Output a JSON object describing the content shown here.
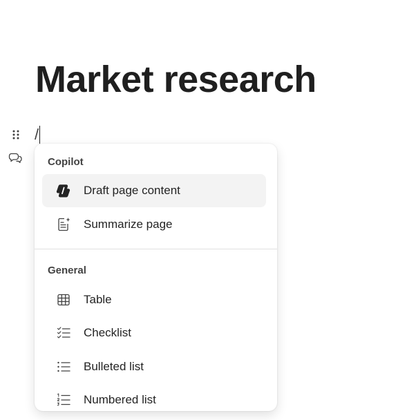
{
  "page": {
    "title": "Market research"
  },
  "editor": {
    "typed_text": "/"
  },
  "gutter": {
    "drag_handle_icon": "drag-dots-icon",
    "comment_icon": "comment-icon"
  },
  "slash_menu": {
    "sections": [
      {
        "label": "Copilot",
        "items": [
          {
            "label": "Draft page content",
            "icon": "copilot-icon",
            "highlighted": true
          },
          {
            "label": "Summarize page",
            "icon": "summarize-icon",
            "highlighted": false
          }
        ]
      },
      {
        "label": "General",
        "items": [
          {
            "label": "Table",
            "icon": "table-icon",
            "highlighted": false
          },
          {
            "label": "Checklist",
            "icon": "checklist-icon",
            "highlighted": false
          },
          {
            "label": "Bulleted list",
            "icon": "bulleted-list-icon",
            "highlighted": false
          },
          {
            "label": "Numbered list",
            "icon": "numbered-list-icon",
            "highlighted": false
          }
        ]
      }
    ]
  },
  "colors": {
    "text": "#242424",
    "highlight": "#f3f3f3",
    "divider": "#e0e0e0"
  }
}
